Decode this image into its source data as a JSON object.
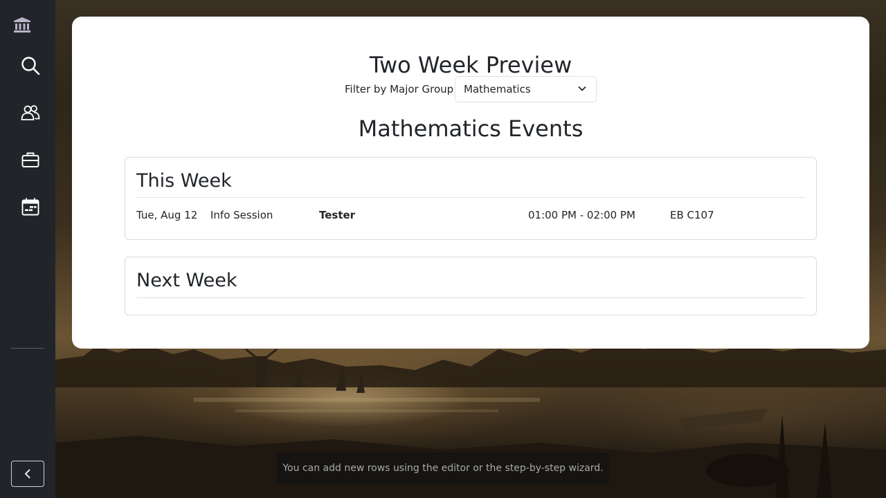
{
  "sidebar": {
    "items": [
      {
        "icon": "bank-icon"
      },
      {
        "icon": "search-icon"
      },
      {
        "icon": "people-icon"
      },
      {
        "icon": "briefcase-icon"
      },
      {
        "icon": "calendar-icon"
      }
    ],
    "collapse_icon": "chevron-left-icon"
  },
  "main": {
    "page_title": "Two Week Preview",
    "filter": {
      "label": "Filter by Major Group:",
      "selected": "Mathematics"
    },
    "events_title": "Mathematics Events",
    "this_week": {
      "heading": "This Week",
      "events": [
        {
          "date": "Tue, Aug 12",
          "type": "Info Session",
          "title": "Tester",
          "time": "01:00 PM - 02:00 PM",
          "location": "EB C107"
        }
      ]
    },
    "next_week": {
      "heading": "Next Week",
      "events": []
    }
  },
  "toast": {
    "message": "You can add new rows using the editor or the step-by-step wizard."
  },
  "colors": {
    "sidebar_bg": "#212529",
    "card_bg": "#ffffff",
    "text": "#212529"
  }
}
